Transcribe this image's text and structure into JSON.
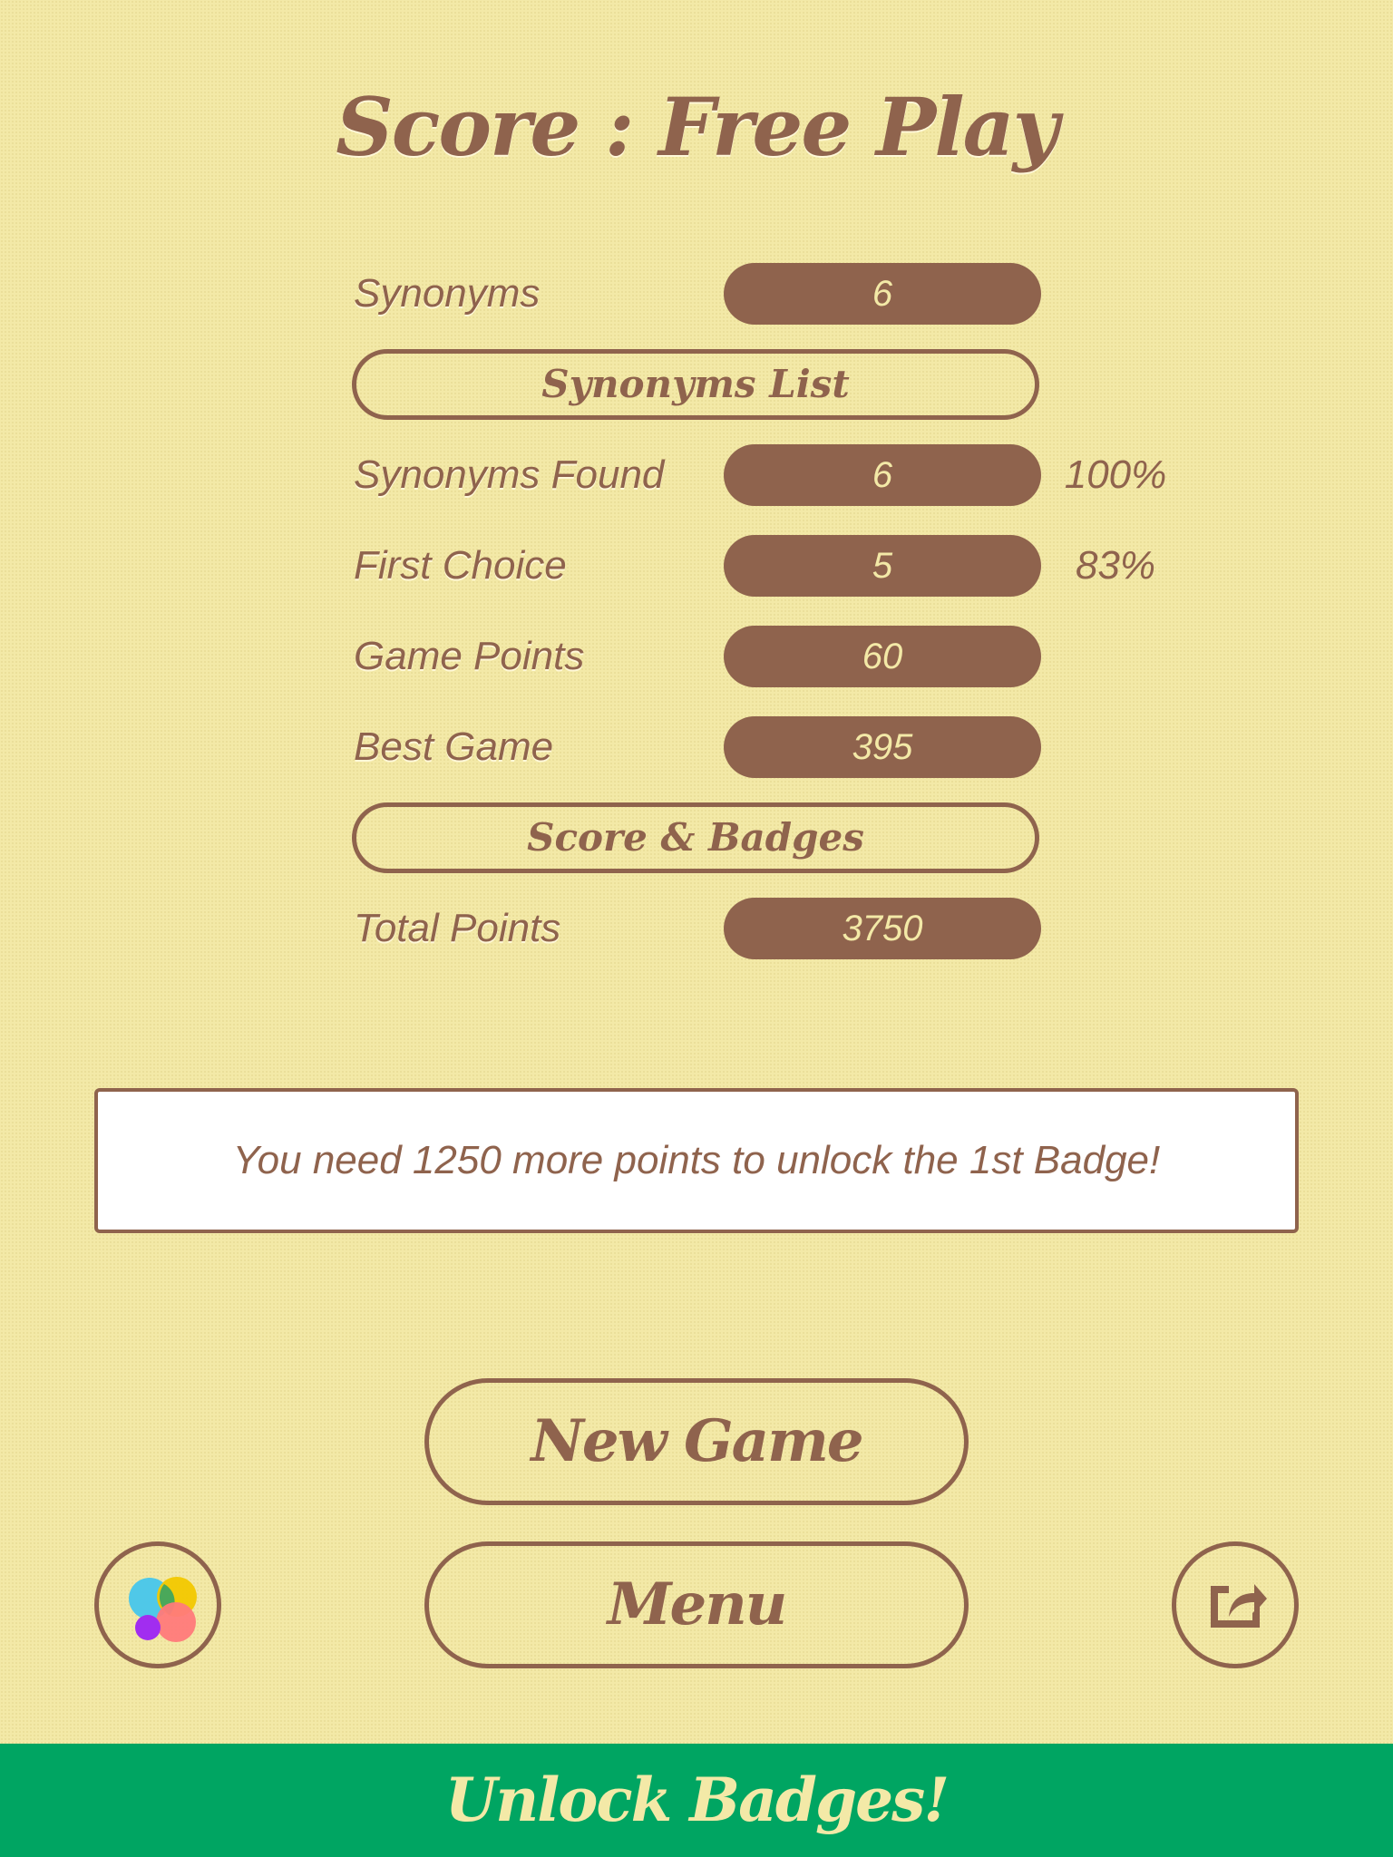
{
  "title": "Score : Free Play",
  "stats": [
    {
      "label": "Synonyms",
      "value": "6",
      "percent": ""
    },
    {
      "label": "Synonyms Found",
      "value": "6",
      "percent": "100%"
    },
    {
      "label": "First Choice",
      "value": "5",
      "percent": "83%"
    },
    {
      "label": "Game Points",
      "value": "60",
      "percent": ""
    },
    {
      "label": "Best Game",
      "value": "395",
      "percent": ""
    },
    {
      "label": "Total Points",
      "value": "3750",
      "percent": ""
    }
  ],
  "buttons": {
    "synonyms_list": "Synonyms List",
    "score_badges": "Score & Badges",
    "new_game": "New Game",
    "menu": "Menu",
    "unlock_badges": "Unlock Badges!"
  },
  "message": "You need 1250 more points to unlock the 1st Badge!",
  "icons": {
    "left": "game-center-icon",
    "right": "share-icon"
  },
  "colors": {
    "background": "#f3e9a7",
    "brown": "#8f634d",
    "footer_green": "#00a562"
  }
}
